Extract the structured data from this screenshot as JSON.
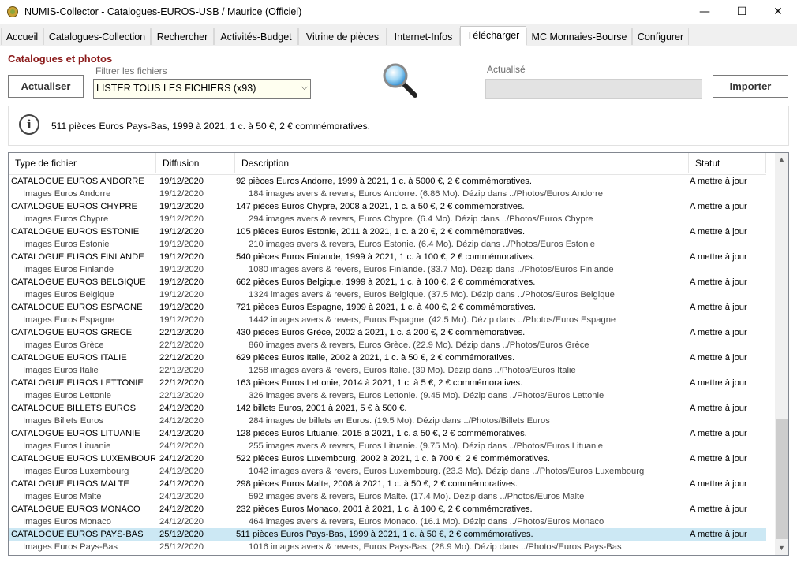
{
  "window": {
    "title": "NUMIS-Collector - Catalogues-EUROS-USB / Maurice (Officiel)"
  },
  "tabs": [
    "Accueil",
    "Catalogues-Collection",
    "Rechercher",
    "Activités-Budget",
    "Vitrine de pièces",
    "Internet-Infos",
    "Télécharger",
    "MC Monnaies-Bourse",
    "Configurer"
  ],
  "active_tab": "Télécharger",
  "section": {
    "title": "Catalogues et photos",
    "refresh_button": "Actualiser",
    "filter_label": "Filtrer les fichiers",
    "filter_value": "LISTER TOUS LES FICHIERS (x93)",
    "updated_label": "Actualisé",
    "import_button": "Importer"
  },
  "info": {
    "text": "511 pièces Euros Pays-Bas, 1999 à 2021, 1 c. à 50 €, 2 € commémoratives."
  },
  "table": {
    "headers": [
      "Type de fichier",
      "Diffusion",
      "Description",
      "Statut"
    ],
    "rows": [
      {
        "type": "CATALOGUE EUROS ANDORRE",
        "date": "19/12/2020",
        "desc": "92 pièces Euros Andorre, 1999 à 2021, 1 c. à 5000 €, 2 € commémoratives.",
        "status": "A mettre à jour"
      },
      {
        "type": "Images Euros Andorre",
        "date": "19/12/2020",
        "desc": "184 images avers & revers, Euros Andorre. (6.86 Mo). Dézip dans ../Photos/Euros Andorre",
        "status": ""
      },
      {
        "type": "CATALOGUE EUROS CHYPRE",
        "date": "19/12/2020",
        "desc": "147 pièces Euros Chypre, 2008 à 2021, 1 c. à 50 €, 2 € commémoratives.",
        "status": "A mettre à jour"
      },
      {
        "type": "Images Euros Chypre",
        "date": "19/12/2020",
        "desc": "294 images avers & revers, Euros Chypre. (6.4 Mo). Dézip dans ../Photos/Euros Chypre",
        "status": ""
      },
      {
        "type": "CATALOGUE EUROS ESTONIE",
        "date": "19/12/2020",
        "desc": "105 pièces Euros Estonie, 2011 à 2021, 1 c. à 20 €, 2 € commémoratives.",
        "status": "A mettre à jour"
      },
      {
        "type": "Images Euros Estonie",
        "date": "19/12/2020",
        "desc": "210 images avers & revers, Euros Estonie. (6.4 Mo). Dézip dans ../Photos/Euros Estonie",
        "status": ""
      },
      {
        "type": "CATALOGUE EUROS FINLANDE",
        "date": "19/12/2020",
        "desc": "540 pièces Euros Finlande, 1999 à 2021, 1 c. à 100 €, 2 € commémoratives.",
        "status": "A mettre à jour"
      },
      {
        "type": "Images Euros Finlande",
        "date": "19/12/2020",
        "desc": "1080 images avers & revers, Euros Finlande. (33.7 Mo). Dézip dans ../Photos/Euros Finlande",
        "status": ""
      },
      {
        "type": "CATALOGUE EUROS BELGIQUE",
        "date": "19/12/2020",
        "desc": "662 pièces Euros Belgique, 1999 à 2021, 1 c. à 100 €, 2 € commémoratives.",
        "status": "A mettre à jour"
      },
      {
        "type": "Images Euros Belgique",
        "date": "19/12/2020",
        "desc": "1324 images avers & revers, Euros Belgique. (37.5 Mo). Dézip dans ../Photos/Euros Belgique",
        "status": ""
      },
      {
        "type": "CATALOGUE EUROS ESPAGNE",
        "date": "19/12/2020",
        "desc": "721 pièces Euros Espagne, 1999 à 2021, 1 c. à 400 €, 2 € commémoratives.",
        "status": "A mettre à jour"
      },
      {
        "type": "Images Euros Espagne",
        "date": "19/12/2020",
        "desc": "1442 images avers & revers, Euros Espagne. (42.5 Mo). Dézip dans ../Photos/Euros Espagne",
        "status": ""
      },
      {
        "type": "CATALOGUE EUROS GRECE",
        "date": "22/12/2020",
        "desc": "430 pièces Euros Grèce, 2002 à 2021, 1 c. à 200 €, 2 € commémoratives.",
        "status": "A mettre à jour"
      },
      {
        "type": "Images Euros Grèce",
        "date": "22/12/2020",
        "desc": "860 images avers & revers, Euros Grèce. (22.9 Mo). Dézip dans ../Photos/Euros Grèce",
        "status": ""
      },
      {
        "type": "CATALOGUE EUROS ITALIE",
        "date": "22/12/2020",
        "desc": "629 pièces Euros Italie, 2002 à 2021, 1 c. à 50 €, 2 € commémoratives.",
        "status": "A mettre à jour"
      },
      {
        "type": "Images Euros Italie",
        "date": "22/12/2020",
        "desc": "1258 images avers & revers, Euros Italie. (39 Mo). Dézip dans ../Photos/Euros Italie",
        "status": ""
      },
      {
        "type": "CATALOGUE EUROS LETTONIE",
        "date": "22/12/2020",
        "desc": "163 pièces Euros Lettonie, 2014 à 2021, 1 c. à 5 €, 2 € commémoratives.",
        "status": "A mettre à jour"
      },
      {
        "type": "Images Euros Lettonie",
        "date": "22/12/2020",
        "desc": "326 images avers & revers, Euros Lettonie. (9.45 Mo). Dézip dans ../Photos/Euros Lettonie",
        "status": ""
      },
      {
        "type": "CATALOGUE BILLETS EUROS",
        "date": "24/12/2020",
        "desc": "142 billets Euros, 2001 à 2021, 5 € à 500 €.",
        "status": "A mettre à jour"
      },
      {
        "type": "Images Billets Euros",
        "date": "24/12/2020",
        "desc": "284 images de billets en Euros. (19.5 Mo). Dézip dans ../Photos/Billets Euros",
        "status": ""
      },
      {
        "type": "CATALOGUE EUROS LITUANIE",
        "date": "24/12/2020",
        "desc": "128 pièces Euros Lituanie, 2015 à 2021, 1 c. à 50 €, 2 € commémoratives.",
        "status": "A mettre à jour"
      },
      {
        "type": "Images Euros Lituanie",
        "date": "24/12/2020",
        "desc": "255 images avers & revers, Euros Lituanie. (9.75 Mo). Dézip dans ../Photos/Euros Lituanie",
        "status": ""
      },
      {
        "type": "CATALOGUE EUROS LUXEMBOURG",
        "date": "24/12/2020",
        "desc": "522 pièces Euros Luxembourg, 2002 à 2021, 1 c. à 700 €, 2 € commémoratives.",
        "status": "A mettre à jour"
      },
      {
        "type": "Images Euros Luxembourg",
        "date": "24/12/2020",
        "desc": "1042 images avers & revers, Euros Luxembourg. (23.3 Mo). Dézip dans ../Photos/Euros Luxembourg",
        "status": ""
      },
      {
        "type": "CATALOGUE EUROS MALTE",
        "date": "24/12/2020",
        "desc": "298 pièces Euros Malte, 2008 à 2021, 1 c. à 50 €, 2 € commémoratives.",
        "status": "A mettre à jour"
      },
      {
        "type": "Images Euros Malte",
        "date": "24/12/2020",
        "desc": "592 images avers & revers, Euros Malte. (17.4 Mo). Dézip dans ../Photos/Euros Malte",
        "status": ""
      },
      {
        "type": "CATALOGUE EUROS MONACO",
        "date": "24/12/2020",
        "desc": "232 pièces Euros Monaco, 2001 à 2021, 1 c. à 100 €, 2 € commémoratives.",
        "status": "A mettre à jour"
      },
      {
        "type": "Images Euros Monaco",
        "date": "24/12/2020",
        "desc": "464 images avers & revers, Euros Monaco. (16.1 Mo). Dézip dans ../Photos/Euros Monaco",
        "status": ""
      },
      {
        "type": "CATALOGUE EUROS PAYS-BAS",
        "date": "25/12/2020",
        "desc": "511 pièces Euros Pays-Bas, 1999 à 2021, 1 c. à 50 €, 2 € commémoratives.",
        "status": "A mettre à jour"
      },
      {
        "type": "Images Euros Pays-Bas",
        "date": "25/12/2020",
        "desc": "1016 images avers & revers, Euros Pays-Bas. (28.9 Mo). Dézip dans ../Photos/Euros Pays-Bas",
        "status": ""
      }
    ],
    "selected_index": 28
  },
  "icons": {
    "app": "coin-app-icon",
    "search": "magnifier-icon",
    "info": "info-icon"
  },
  "colors": {
    "section_title": "#8b1a1a",
    "selection": "#cce8f4",
    "filter_bg": "#fffff0"
  }
}
